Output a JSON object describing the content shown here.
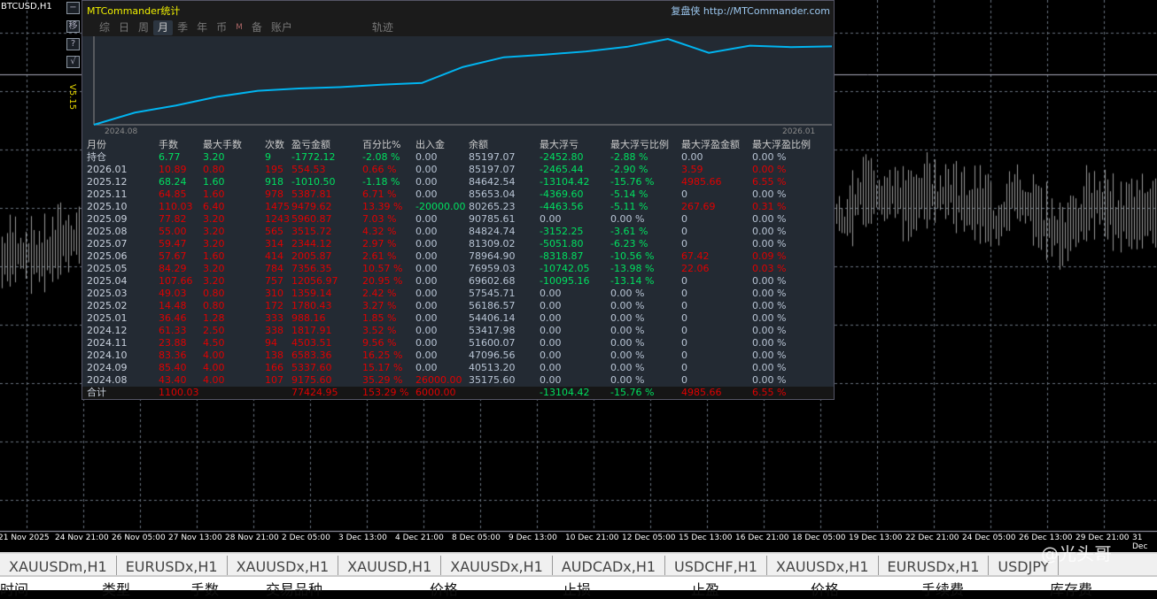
{
  "chart_window": {
    "symbol": "BTCUSD,H1",
    "side_buttons": [
      "−",
      "移",
      "?",
      "√"
    ],
    "version": "V5.15",
    "time_axis": [
      "21 Nov 2025",
      "24 Nov 21:00",
      "26 Nov 05:00",
      "27 Nov 13:00",
      "28 Nov 21:00",
      "2 Dec 05:00",
      "3 Dec 13:00",
      "4 Dec 21:00",
      "8 Dec 05:00",
      "9 Dec 13:00",
      "10 Dec 21:00",
      "12 Dec 05:00",
      "15 Dec 13:00",
      "16 Dec 21:00",
      "18 Dec 05:00",
      "19 Dec 13:00",
      "22 Dec 21:00",
      "24 Dec 05:00",
      "26 Dec 13:00",
      "29 Dec 21:00",
      "31 Dec"
    ]
  },
  "panel": {
    "title": "MTCommander统计",
    "brand": "复盘侠 http://MTCommander.com",
    "tabs": [
      {
        "label": "综"
      },
      {
        "label": "日"
      },
      {
        "label": "周"
      },
      {
        "label": "月",
        "active": true
      },
      {
        "label": "季"
      },
      {
        "label": "年"
      },
      {
        "label": "币"
      },
      {
        "label": "M"
      },
      {
        "label": "备"
      },
      {
        "label": "账户"
      },
      {
        "label": "轨迹"
      }
    ],
    "equity_chart": {
      "x_start": "2024.08",
      "x_end": "2026.01",
      "line_color": "#00b4f0"
    },
    "columns": [
      "月份",
      "手数",
      "最大手数",
      "次数",
      "盈亏金额",
      "百分比%",
      "出入金",
      "余额",
      "最大浮亏",
      "最大浮亏比例",
      "最大浮盈金额",
      "最大浮盈比例"
    ],
    "rows": [
      [
        "持仓",
        "6.77",
        "3.20",
        "9",
        "-1772.12",
        "-2.08 %",
        "0.00",
        "85197.07",
        "-2452.80",
        "-2.88 %",
        "0.00",
        "0.00 %"
      ],
      [
        "2026.01",
        "10.89",
        "0.80",
        "195",
        "554.53",
        "0.66 %",
        "0.00",
        "85197.07",
        "-2465.44",
        "-2.90 %",
        "3.59",
        "0.00 %"
      ],
      [
        "2025.12",
        "68.24",
        "1.60",
        "918",
        "-1010.50",
        "-1.18 %",
        "0.00",
        "84642.54",
        "-13104.42",
        "-15.76 %",
        "4985.66",
        "6.55 %"
      ],
      [
        "2025.11",
        "64.85",
        "1.60",
        "978",
        "5387.81",
        "6.71 %",
        "0.00",
        "85653.04",
        "-4369.60",
        "-5.14 %",
        "0",
        "0.00 %"
      ],
      [
        "2025.10",
        "110.03",
        "6.40",
        "1475",
        "9479.62",
        "13.39 %",
        "-20000.00",
        "80265.23",
        "-4463.56",
        "-5.11 %",
        "267.69",
        "0.31 %"
      ],
      [
        "2025.09",
        "77.82",
        "3.20",
        "1243",
        "5960.87",
        "7.03 %",
        "0.00",
        "90785.61",
        "0.00",
        "0.00 %",
        "0",
        "0.00 %"
      ],
      [
        "2025.08",
        "55.00",
        "3.20",
        "565",
        "3515.72",
        "4.32 %",
        "0.00",
        "84824.74",
        "-3152.25",
        "-3.61 %",
        "0",
        "0.00 %"
      ],
      [
        "2025.07",
        "59.47",
        "3.20",
        "314",
        "2344.12",
        "2.97 %",
        "0.00",
        "81309.02",
        "-5051.80",
        "-6.23 %",
        "0",
        "0.00 %"
      ],
      [
        "2025.06",
        "57.67",
        "1.60",
        "414",
        "2005.87",
        "2.61 %",
        "0.00",
        "78964.90",
        "-8318.87",
        "-10.56 %",
        "67.42",
        "0.09 %"
      ],
      [
        "2025.05",
        "84.29",
        "3.20",
        "784",
        "7356.35",
        "10.57 %",
        "0.00",
        "76959.03",
        "-10742.05",
        "-13.98 %",
        "22.06",
        "0.03 %"
      ],
      [
        "2025.04",
        "107.66",
        "3.20",
        "757",
        "12056.97",
        "20.95 %",
        "0.00",
        "69602.68",
        "-10095.16",
        "-13.14 %",
        "0",
        "0.00 %"
      ],
      [
        "2025.03",
        "49.03",
        "0.80",
        "310",
        "1359.14",
        "2.42 %",
        "0.00",
        "57545.71",
        "0.00",
        "0.00 %",
        "0",
        "0.00 %"
      ],
      [
        "2025.02",
        "14.48",
        "0.80",
        "172",
        "1780.43",
        "3.27 %",
        "0.00",
        "56186.57",
        "0.00",
        "0.00 %",
        "0",
        "0.00 %"
      ],
      [
        "2025.01",
        "36.46",
        "1.28",
        "333",
        "988.16",
        "1.85 %",
        "0.00",
        "54406.14",
        "0.00",
        "0.00 %",
        "0",
        "0.00 %"
      ],
      [
        "2024.12",
        "61.33",
        "2.50",
        "338",
        "1817.91",
        "3.52 %",
        "0.00",
        "53417.98",
        "0.00",
        "0.00 %",
        "0",
        "0.00 %"
      ],
      [
        "2024.11",
        "23.88",
        "4.50",
        "94",
        "4503.51",
        "9.56 %",
        "0.00",
        "51600.07",
        "0.00",
        "0.00 %",
        "0",
        "0.00 %"
      ],
      [
        "2024.10",
        "83.36",
        "4.00",
        "138",
        "6583.36",
        "16.25 %",
        "0.00",
        "47096.56",
        "0.00",
        "0.00 %",
        "0",
        "0.00 %"
      ],
      [
        "2024.09",
        "85.40",
        "4.00",
        "166",
        "5337.60",
        "15.17 %",
        "0.00",
        "40513.20",
        "0.00",
        "0.00 %",
        "0",
        "0.00 %"
      ],
      [
        "2024.08",
        "43.40",
        "4.00",
        "107",
        "9175.60",
        "35.29 %",
        "26000.00",
        "35175.60",
        "0.00",
        "0.00 %",
        "0",
        "0.00 %"
      ]
    ],
    "total": [
      "合计",
      "1100.03",
      "",
      "",
      "77424.95",
      "153.29 %",
      "6000.00",
      "",
      "-13104.42",
      "-15.76 %",
      "4985.66",
      "6.55 %"
    ]
  },
  "chart_tabs": [
    "XAUUSDm,H1",
    "EURUSDx,H1",
    "XAUUSDx,H1",
    "XAUUSD,H1",
    "XAUUSDx,H1",
    "AUDCADx,H1",
    "USDCHF,H1",
    "XAUUSDx,H1",
    "EURUSDx,H1",
    "USDJPY"
  ],
  "trade_columns": [
    "时间",
    "类型",
    "手数",
    "交易品种",
    "价格",
    "止损",
    "止盈",
    "价格",
    "手续费",
    "库存费"
  ],
  "watermark": "@光头哥"
}
